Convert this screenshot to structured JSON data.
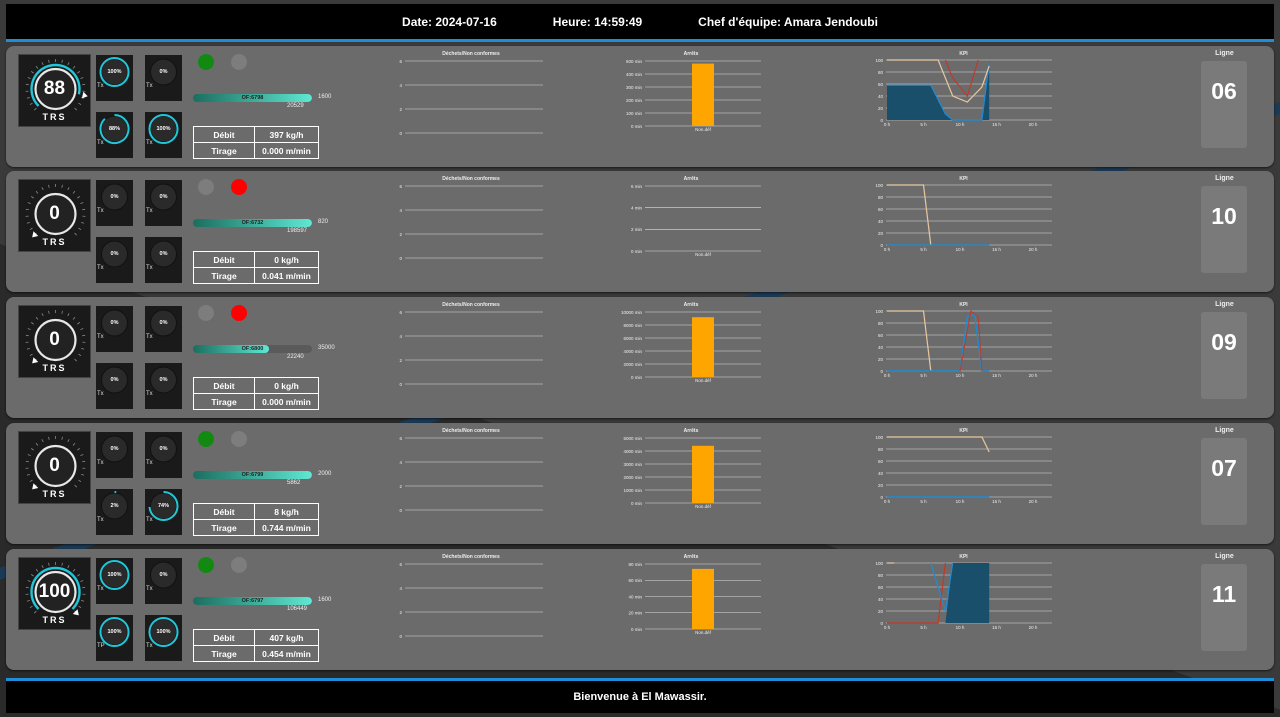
{
  "header": {
    "date": "Date: 2024-07-16",
    "time": "Heure: 14:59:49",
    "chef": "Chef d'équipe: Amara Jendoubi"
  },
  "footer": {
    "welcome": "Bienvenue à El Mawassir."
  },
  "colors": {
    "green": "#128a12",
    "red": "#ff0000",
    "off": "#7d7d7d",
    "accent": "#21c7d9",
    "bar": "#ffa500",
    "kpi_fill": "#1a4f6b",
    "kpi_blue": "#1f8bd1",
    "kpi_beige": "#e8c7a0",
    "kpi_red": "#c0392b"
  },
  "labels": {
    "trs": "TRS",
    "debit": "Débit",
    "tirage": "Tirage",
    "ligne": "Ligne",
    "dechets_title": "Déchets/Non conformes",
    "arrets_title": "Arrêts",
    "kpi_title": "KPI",
    "arrets_category": "Non.déf"
  },
  "lines": [
    {
      "ligne": "06",
      "trs": "88",
      "trs_frac": 0.88,
      "minis": [
        {
          "value": "100%",
          "frac": 1.0,
          "label": "Tx"
        },
        {
          "value": "0%",
          "frac": 0.0,
          "label": "Tx"
        },
        {
          "value": "88%",
          "frac": 0.88,
          "label": "Tx"
        },
        {
          "value": "100%",
          "frac": 1.0,
          "label": "Tx"
        }
      ],
      "lights": [
        "green",
        "off"
      ],
      "of": "OF:6798",
      "of_max": "1600",
      "of_qty": "20529",
      "of_frac": 1.0,
      "debit": "397 kg/h",
      "tirage": "0.000 m/min",
      "arrets": {
        "ticks": [
          "500 min",
          "400 min",
          "300 min",
          "200 min",
          "100 min",
          "0 min"
        ],
        "ymax": 500,
        "value": 480
      }
    },
    {
      "ligne": "10",
      "trs": "0",
      "trs_frac": 0.0,
      "minis": [
        {
          "value": "0%",
          "frac": 0.0,
          "label": "Tx"
        },
        {
          "value": "0%",
          "frac": 0.0,
          "label": "Tx"
        },
        {
          "value": "0%",
          "frac": 0.0,
          "label": "Tx"
        },
        {
          "value": "0%",
          "frac": 0.0,
          "label": "Tx"
        }
      ],
      "lights": [
        "off",
        "red"
      ],
      "of": "OF:6732",
      "of_max": "820",
      "of_qty": "198597",
      "of_frac": 1.0,
      "debit": "0 kg/h",
      "tirage": "0.041 m/min",
      "arrets": {
        "ticks": [
          "6 min",
          "4 min",
          "2 min",
          "0 min"
        ],
        "ymax": 6,
        "value": 0
      }
    },
    {
      "ligne": "09",
      "trs": "0",
      "trs_frac": 0.0,
      "minis": [
        {
          "value": "0%",
          "frac": 0.0,
          "label": "Tx"
        },
        {
          "value": "0%",
          "frac": 0.0,
          "label": "Tx"
        },
        {
          "value": "0%",
          "frac": 0.0,
          "label": "Tx"
        },
        {
          "value": "0%",
          "frac": 0.0,
          "label": "Tx"
        }
      ],
      "lights": [
        "off",
        "red"
      ],
      "of": "OF:6800",
      "of_max": "35000",
      "of_qty": "22240",
      "of_frac": 0.64,
      "debit": "0 kg/h",
      "tirage": "0.000 m/min",
      "arrets": {
        "ticks": [
          "10000 min",
          "8000 min",
          "6000 min",
          "4000 min",
          "2000 min",
          "0 min"
        ],
        "ymax": 10000,
        "value": 9200
      }
    },
    {
      "ligne": "07",
      "trs": "0",
      "trs_frac": 0.0,
      "minis": [
        {
          "value": "0%",
          "frac": 0.0,
          "label": "Tx"
        },
        {
          "value": "0%",
          "frac": 0.0,
          "label": "Tx"
        },
        {
          "value": "2%",
          "frac": 0.02,
          "label": "Tx"
        },
        {
          "value": "74%",
          "frac": 0.74,
          "label": "Tx"
        }
      ],
      "lights": [
        "green",
        "off"
      ],
      "of": "OF:6799",
      "of_max": "2000",
      "of_qty": "5862",
      "of_frac": 1.0,
      "debit": "8 kg/h",
      "tirage": "0.744 m/min",
      "arrets": {
        "ticks": [
          "5000 min",
          "4000 min",
          "3000 min",
          "2000 min",
          "1000 min",
          "0 min"
        ],
        "ymax": 5000,
        "value": 4400
      }
    },
    {
      "ligne": "11",
      "trs": "100",
      "trs_frac": 1.0,
      "minis": [
        {
          "value": "100%",
          "frac": 1.0,
          "label": "Tx"
        },
        {
          "value": "0%",
          "frac": 0.0,
          "label": "Tx"
        },
        {
          "value": "100%",
          "frac": 1.0,
          "label": "TP"
        },
        {
          "value": "100%",
          "frac": 1.0,
          "label": "Tx"
        }
      ],
      "lights": [
        "green",
        "off"
      ],
      "of": "OF:6797",
      "of_max": "1600",
      "of_qty": "106449",
      "of_frac": 1.0,
      "debit": "407 kg/h",
      "tirage": "0.454 m/min",
      "arrets": {
        "ticks": [
          "80 min",
          "60 min",
          "40 min",
          "20 min",
          "0 min"
        ],
        "ymax": 80,
        "value": 74
      }
    }
  ],
  "dechets": {
    "ticks": [
      "6",
      "4",
      "2",
      "0"
    ]
  },
  "kpi": {
    "y_ticks": [
      "100",
      "80",
      "60",
      "40",
      "20",
      "0"
    ],
    "x_ticks": [
      "0 h",
      "5 h",
      "10 h",
      "15 h",
      "20 h"
    ]
  }
}
